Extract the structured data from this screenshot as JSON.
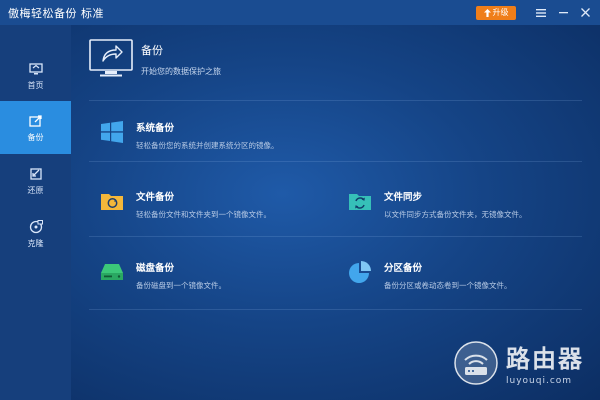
{
  "window": {
    "title": "傲梅轻松备份 标准",
    "upgrade_label": "升级",
    "menu_icon": "menu-icon",
    "minimize_icon": "minimize-icon",
    "close_icon": "close-icon"
  },
  "sidebar": {
    "items": [
      {
        "label": "首页",
        "icon": "home-icon",
        "active": false
      },
      {
        "label": "备份",
        "icon": "backup-icon",
        "active": true
      },
      {
        "label": "还原",
        "icon": "restore-icon",
        "active": false
      },
      {
        "label": "克隆",
        "icon": "clone-icon",
        "active": false
      }
    ]
  },
  "header": {
    "title": "备份",
    "subtitle": "开始您的数据保护之旅"
  },
  "cards": [
    {
      "title": "系统备份",
      "desc": "轻松备份您的系统并创建系统分区的镜像。",
      "icon": "windows-icon"
    },
    {
      "title": "文件备份",
      "desc": "轻松备份文件和文件夹到一个镜像文件。",
      "icon": "folder-backup-icon"
    },
    {
      "title": "文件同步",
      "desc": "以文件同步方式备份文件夹，无镜像文件。",
      "icon": "file-sync-icon"
    },
    {
      "title": "磁盘备份",
      "desc": "备份磁盘到一个镜像文件。",
      "icon": "disk-icon"
    },
    {
      "title": "分区备份",
      "desc": "备份分区或卷动态卷到一个镜像文件。",
      "icon": "partition-icon"
    }
  ],
  "watermark": {
    "main": "路由器",
    "sub": "luyouqi.com"
  },
  "colors": {
    "titlebar": "#1a4c91",
    "sidebar": "#163f7c",
    "active_item": "#2a8de0",
    "upgrade_button": "#ef7e1a",
    "accent_icon": "#42a6ec"
  }
}
